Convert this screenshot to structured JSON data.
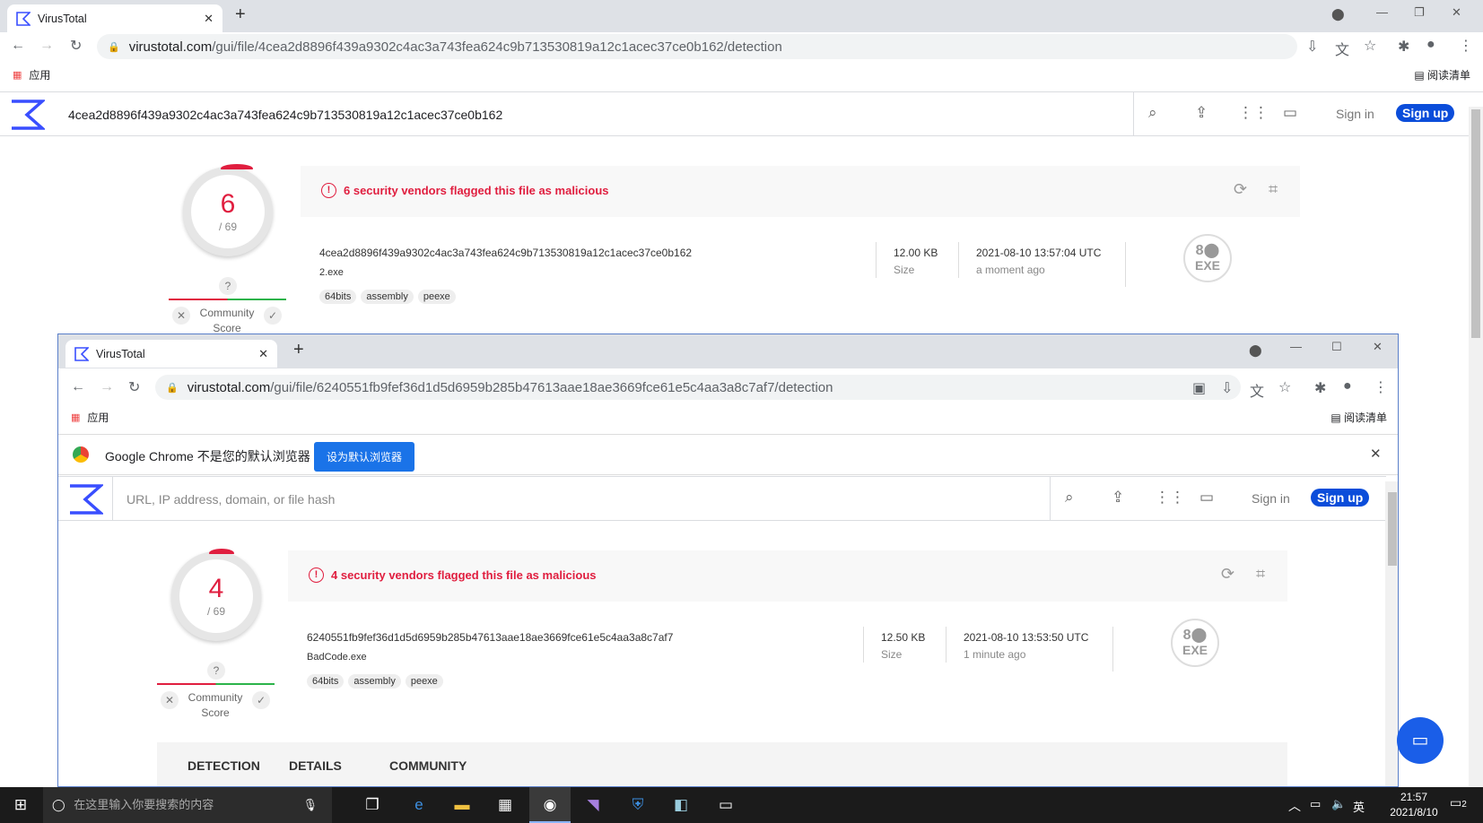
{
  "bg": {
    "tab_title": "VirusTotal",
    "url_host": "virustotal.com",
    "url_path": "/gui/file/4cea2d8896f439a9302c4ac3a743fea624c9b713530819a12c1acec37ce0b162/detection",
    "apps_label": "应用",
    "reading_list": "阅读清单",
    "search_value": "4cea2d8896f439a9302c4ac3a743fea624c9b713530819a12c1acec37ce0b162",
    "sign_in": "Sign in",
    "sign_up": "Sign up",
    "score": "6",
    "total": "/ 69",
    "alert": "6 security vendors flagged this file as malicious",
    "hash": "4cea2d8896f439a9302c4ac3a743fea624c9b713530819a12c1acec37ce0b162",
    "filename": "2.exe",
    "tags": [
      "64bits",
      "assembly",
      "peexe"
    ],
    "size_value": "12.00 KB",
    "size_label": "Size",
    "date_value": "2021-08-10 13:57:04 UTC",
    "date_label": "a moment ago",
    "community_label": "Community Score",
    "exe": "EXE"
  },
  "fg": {
    "tab_title": "VirusTotal",
    "url_host": "virustotal.com",
    "url_path": "/gui/file/6240551fb9fef36d1d5d6959b285b47613aae18ae3669fce61e5c4aa3a8c7af7/detection",
    "apps_label": "应用",
    "reading_list": "阅读清单",
    "infobar_text": "Google Chrome 不是您的默认浏览器",
    "infobar_button": "设为默认浏览器",
    "search_placeholder": "URL, IP address, domain, or file hash",
    "sign_in": "Sign in",
    "sign_up": "Sign up",
    "score": "4",
    "total": "/ 69",
    "alert": "4 security vendors flagged this file as malicious",
    "hash": "6240551fb9fef36d1d5d6959b285b47613aae18ae3669fce61e5c4aa3a8c7af7",
    "filename": "BadCode.exe",
    "tags": [
      "64bits",
      "assembly",
      "peexe"
    ],
    "size_value": "12.50 KB",
    "size_label": "Size",
    "date_value": "2021-08-10 13:53:50 UTC",
    "date_label": "1 minute ago",
    "community_label": "Community Score",
    "exe": "EXE",
    "subnav": [
      "DETECTION",
      "DETAILS",
      "COMMUNITY"
    ]
  },
  "taskbar": {
    "search_text": "在这里输入你要搜索的内容",
    "time": "21:57",
    "date": "2021/8/10",
    "ime": "英",
    "notif_count": "2"
  },
  "icons": {
    "tab": "virustotal-icon",
    "close": "close-icon",
    "search": "search-icon",
    "upload": "upload-icon",
    "apps": "grid-icon",
    "chat": "chat-icon",
    "reload": "reload-icon"
  }
}
